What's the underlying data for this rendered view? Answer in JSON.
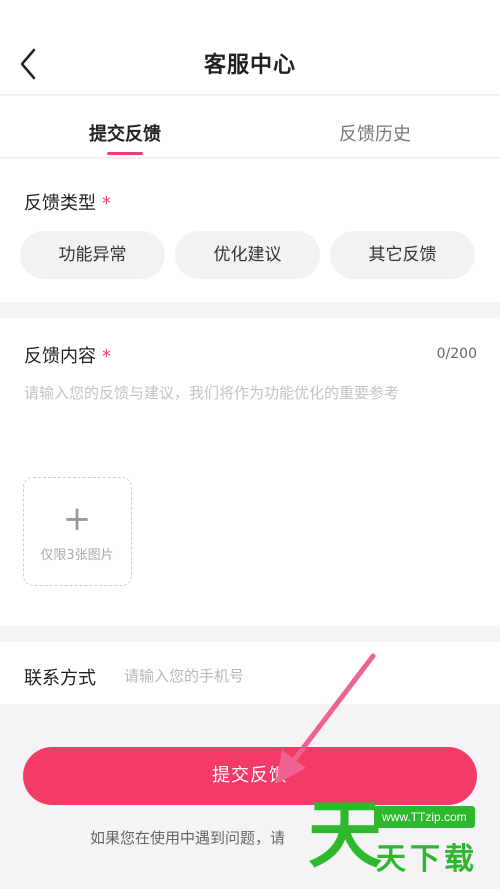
{
  "header": {
    "title": "客服中心"
  },
  "tabs": [
    {
      "label": "提交反馈",
      "active": true
    },
    {
      "label": "反馈历史",
      "active": false
    }
  ],
  "feedback_type": {
    "label": "反馈类型",
    "required_mark": "*",
    "options": [
      "功能异常",
      "优化建议",
      "其它反馈"
    ]
  },
  "feedback_content": {
    "label": "反馈内容",
    "required_mark": "*",
    "counter": "0/200",
    "placeholder": "请输入您的反馈与建议，我们将作为功能优化的重要参考",
    "upload": {
      "plus": "+",
      "hint": "仅限3张图片"
    }
  },
  "contact": {
    "label": "联系方式",
    "placeholder": "请输入您的手机号"
  },
  "submit_label": "提交反馈",
  "footer_note": "如果您在使用中遇到问题，请",
  "watermark": {
    "big_char": "天",
    "url": "www.TTzip.com",
    "text": "天下载"
  },
  "colors": {
    "accent": "#f23c6a",
    "watermark": "#2db82e"
  }
}
